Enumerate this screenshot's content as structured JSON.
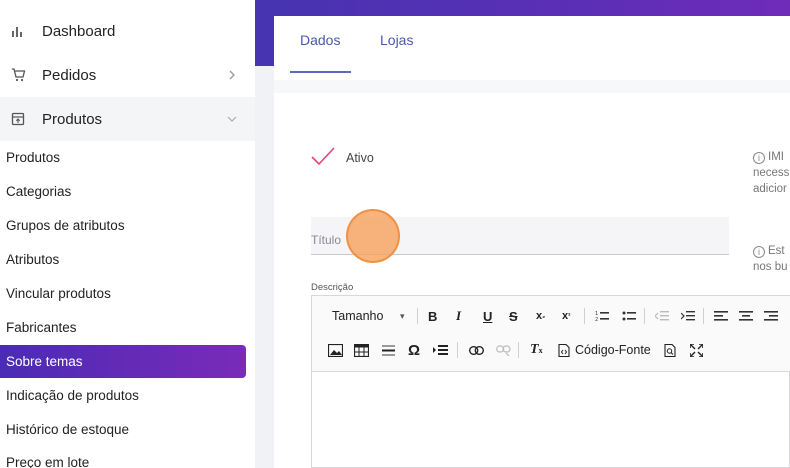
{
  "sidebar": {
    "items": [
      {
        "label": "Dashboard",
        "icon": "bar-chart-icon"
      },
      {
        "label": "Pedidos",
        "icon": "cart-icon"
      },
      {
        "label": "Produtos",
        "icon": "box-icon"
      }
    ],
    "sub_items": [
      "Produtos",
      "Categorias",
      "Grupos de atributos",
      "Atributos",
      "Vincular produtos",
      "Fabricantes",
      "Sobre temas",
      "Indicação de produtos",
      "Histórico de estoque",
      "Preço em lote"
    ],
    "active_sub_item": "Sobre temas"
  },
  "tabs": {
    "dados": "Dados",
    "lojas": "Lojas"
  },
  "form": {
    "ativo_label": "Ativo",
    "info1": {
      "line1": "IMI",
      "line2": "necess",
      "line3": "adicior"
    },
    "info2": {
      "line1": "Est",
      "line2": "nos bu"
    },
    "titulo_placeholder": "Título",
    "descricao_label": "Descrição"
  },
  "editor": {
    "size_label": "Tamanho",
    "source_label": "Código-Fonte"
  },
  "colors": {
    "accent": "#4a2bb5",
    "accent_end": "#7a2bb8",
    "tab_text": "#4a57b0",
    "check": "#e0457b"
  }
}
